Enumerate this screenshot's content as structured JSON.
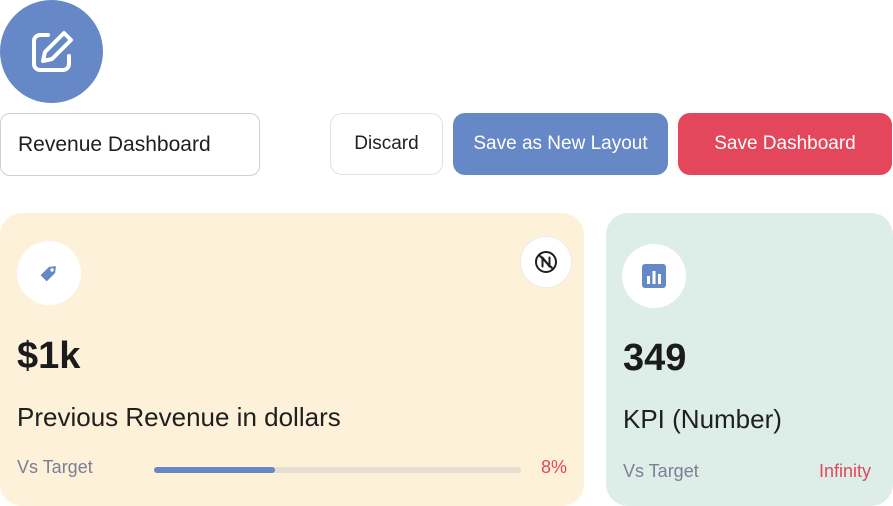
{
  "editor": {
    "icon": "edit-icon",
    "name_value": "Revenue Dashboard",
    "discard_label": "Discard",
    "save_new_layout_label": "Save as New Layout",
    "save_dashboard_label": "Save Dashboard"
  },
  "colors": {
    "primary_blue": "#6688c6",
    "accent_red": "#e4475b",
    "card_revenue_bg": "#fef1da",
    "card_kpi_bg": "#ddede8"
  },
  "cards": [
    {
      "icon": "tag-icon",
      "action_icon": "unlink-icon",
      "value": "$1k",
      "title": "Previous Revenue in dollars",
      "vs_label": "Vs Target",
      "progress_fraction": 0.33,
      "percent": "8%"
    },
    {
      "icon": "bar-chart-icon",
      "value": "349",
      "title": "KPI (Number)",
      "vs_label": "Vs Target",
      "percent": "Infinity"
    }
  ]
}
